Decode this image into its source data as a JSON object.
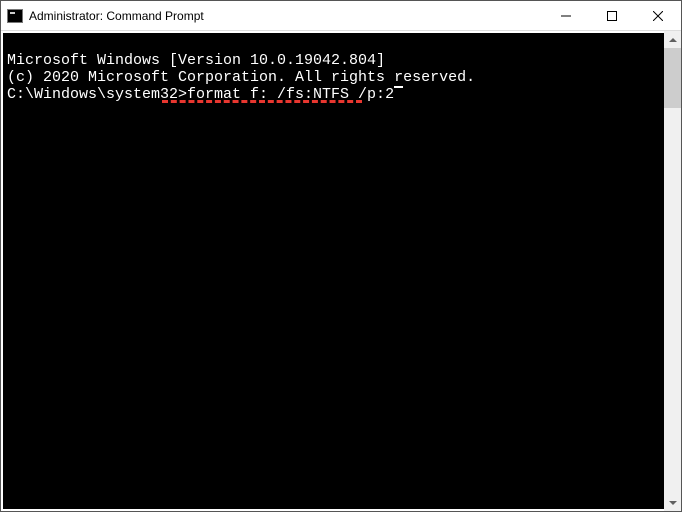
{
  "window": {
    "title": "Administrator: Command Prompt"
  },
  "terminal": {
    "line1": "Microsoft Windows [Version 10.0.19042.804]",
    "line2": "(c) 2020 Microsoft Corporation. All rights reserved.",
    "blank": "",
    "prompt": "C:\\Windows\\system32>",
    "command": "format f: /fs:NTFS /p:2"
  },
  "colors": {
    "annotation": "#e8362f",
    "terminal_bg": "#000000",
    "terminal_fg": "#ffffff"
  }
}
